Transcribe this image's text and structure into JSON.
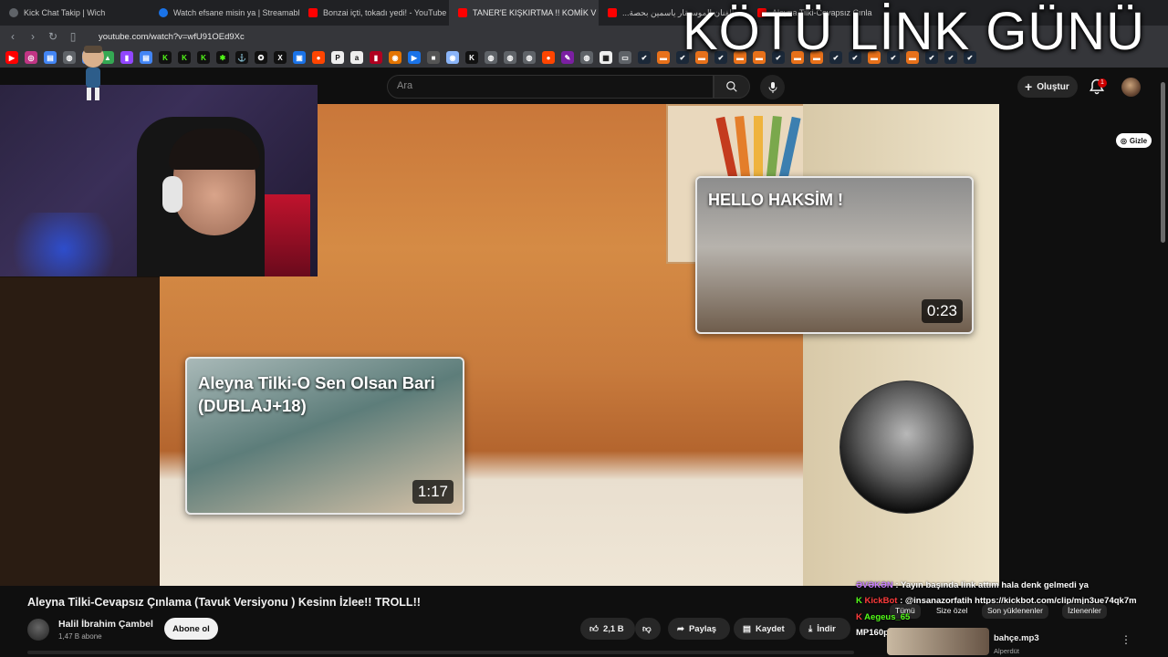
{
  "tabs": [
    {
      "title": "Kick Chat Takip | Wich",
      "favicon_color": "#5f6368",
      "active": false
    },
    {
      "title": "Watch efsane misin ya | Streamable",
      "favicon_color": "#1a73e8",
      "active": false
    },
    {
      "title": "Bonzai içti, tokadı yedi! - YouTube",
      "favicon_color": "#ff0000",
      "active": false
    },
    {
      "title": "TANER'E KIŞKIRTMA !! KOMİK V",
      "favicon_color": "#ff0000",
      "active": true
    },
    {
      "title": "...الفنان الموسيقار ياسمين بحصة ...",
      "favicon_color": "#ff0000",
      "active": false
    },
    {
      "title": "Aleyna Tilki-Cevapsız Çınla",
      "favicon_color": "#ff0000",
      "active": false
    }
  ],
  "browser": {
    "url": "youtube.com/watch?v=wfU91OEd9Xc"
  },
  "overlay": {
    "title": "KÖTÜ LİNK GÜNÜ",
    "gizle_label": "Gizle"
  },
  "header": {
    "search_placeholder": "Ara",
    "create_label": "Oluştur",
    "notification_count": "1"
  },
  "cards": {
    "hello": {
      "title": "HELLO HAKSİM !",
      "duration": "0:23"
    },
    "aleyna": {
      "title": "Aleyna Tilki-O Sen Olsan Bari (DUBLAJ+18)",
      "duration": "1:17"
    }
  },
  "video": {
    "title": "Aleyna Tilki-Cevapsız Çınlama (Tavuk Versiyonu ) Kesinn İzlee!! TROLL!!",
    "channel_name": "Halil İbrahim Çambel",
    "subscribers": "1,47 B abone",
    "subscribe_label": "Abone ol",
    "likes": "2,1 B",
    "share_label": "Paylaş",
    "save_label": "Kaydet",
    "download_label": "İndir"
  },
  "chat": {
    "line1_user": "ƏVƏKƏN",
    "line1_text": ": Yayın başında link attım hala denk gelmedi ya",
    "line2_user": "KickBot",
    "line2_text": ": @insanazorfatih https://kickbot.com/clip/mjn3ue74qk7m",
    "line3_user": "Aegeus_65",
    "line3_text": "",
    "line4_user": "MP160p",
    "line4_text": ":"
  },
  "sidebar": {
    "chips": [
      "Tümü",
      "Size özel",
      "Son yüklenenler",
      "İzlenenler"
    ],
    "item_title": "bahçe.mp3",
    "item_channel": "Alperdüt"
  },
  "colors": {
    "youtube_red": "#ff0000",
    "background": "#0f0f0f",
    "notification_red": "#cc0000"
  }
}
